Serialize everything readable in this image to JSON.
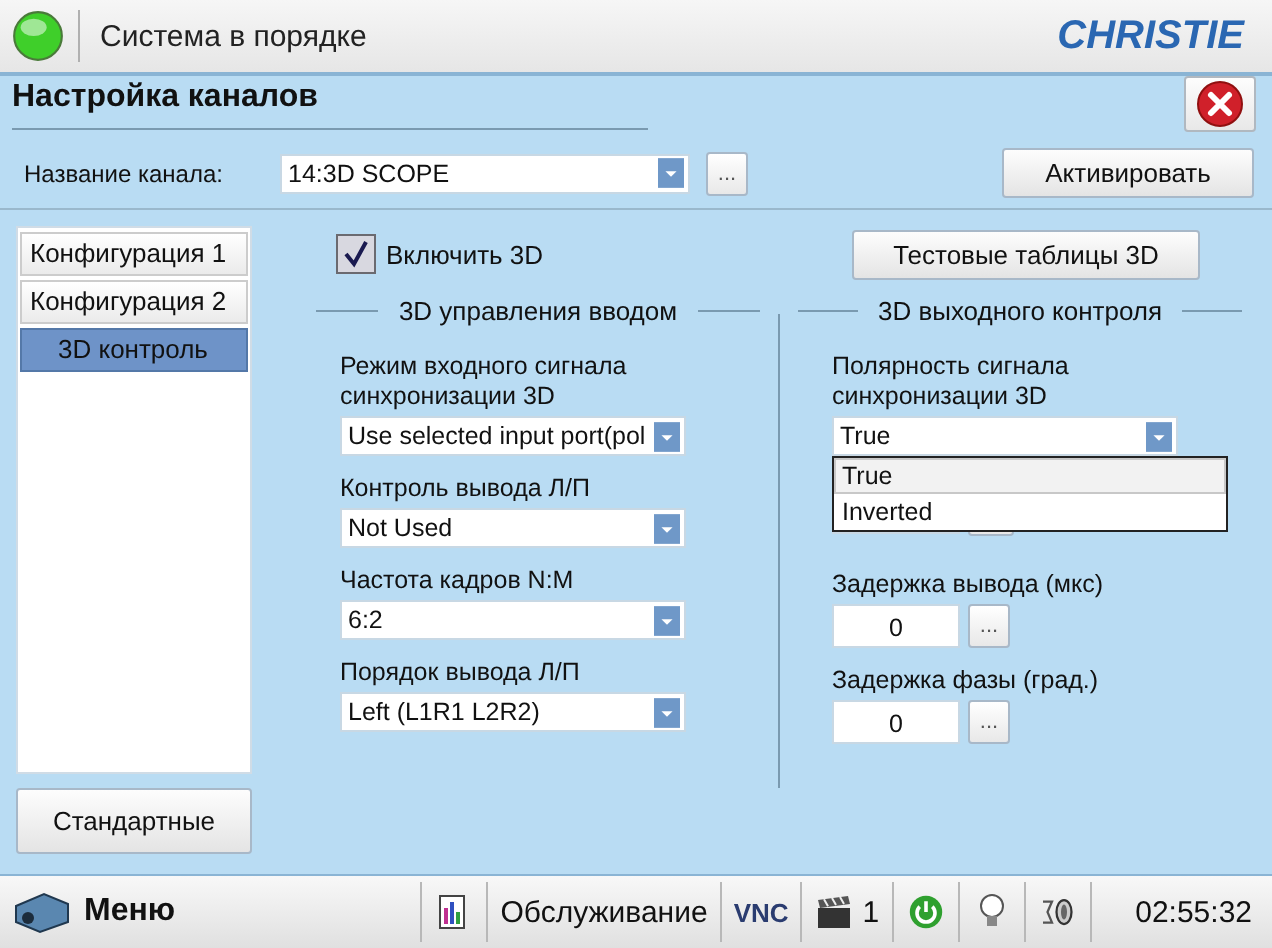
{
  "status_bar": {
    "ok": true,
    "text": "Система в порядке",
    "logo": "CHRISTIE"
  },
  "dialog": {
    "title": "Настройка каналов",
    "channel_label": "Название канала:",
    "channel_value": "14:3D SCOPE",
    "more_button": "...",
    "activate_button": "Активировать"
  },
  "nav": [
    {
      "label": "Конфигурация 1",
      "selected": false
    },
    {
      "label": "Конфигурация 2",
      "selected": false
    },
    {
      "label": "3D контроль",
      "selected": true
    }
  ],
  "defaults_button": "Стандартные",
  "enable_3d": {
    "label": "Включить 3D",
    "checked": true
  },
  "test_patterns_button": "Тестовые таблицы 3D",
  "input_section": {
    "title": "3D управления вводом",
    "fields": [
      {
        "kind": "combo",
        "label": "Режим входного сигнала синхронизации 3D",
        "value": "Use selected input port(pol"
      },
      {
        "kind": "combo",
        "label": "Контроль вывода Л/П",
        "value": "Not Used"
      },
      {
        "kind": "combo",
        "label": "Частота кадров N:M",
        "value": "6:2"
      },
      {
        "kind": "combo",
        "label": "Порядок вывода Л/П",
        "value": "Left (L1R1 L2R2)"
      }
    ]
  },
  "output_section": {
    "title": "3D выходного контроля",
    "fields": [
      {
        "kind": "combo",
        "label": "Полярность сигнала синхронизации 3D",
        "value": "True",
        "expanded": true,
        "options": [
          {
            "label": "True",
            "selected": true
          },
          {
            "label": "Inverted",
            "selected": false
          }
        ]
      },
      {
        "kind": "covered"
      },
      {
        "kind": "number",
        "label": "Задержка вывода (мкс)",
        "value": "0",
        "button": "..."
      },
      {
        "kind": "number",
        "label": "Задержка фазы (град.)",
        "value": "0",
        "button": "..."
      }
    ]
  },
  "taskbar": {
    "menu": "Меню",
    "service": "Обслуживание",
    "vnc": "VNC",
    "jobs": "1",
    "clock": "02:55:32",
    "power_on": true
  }
}
